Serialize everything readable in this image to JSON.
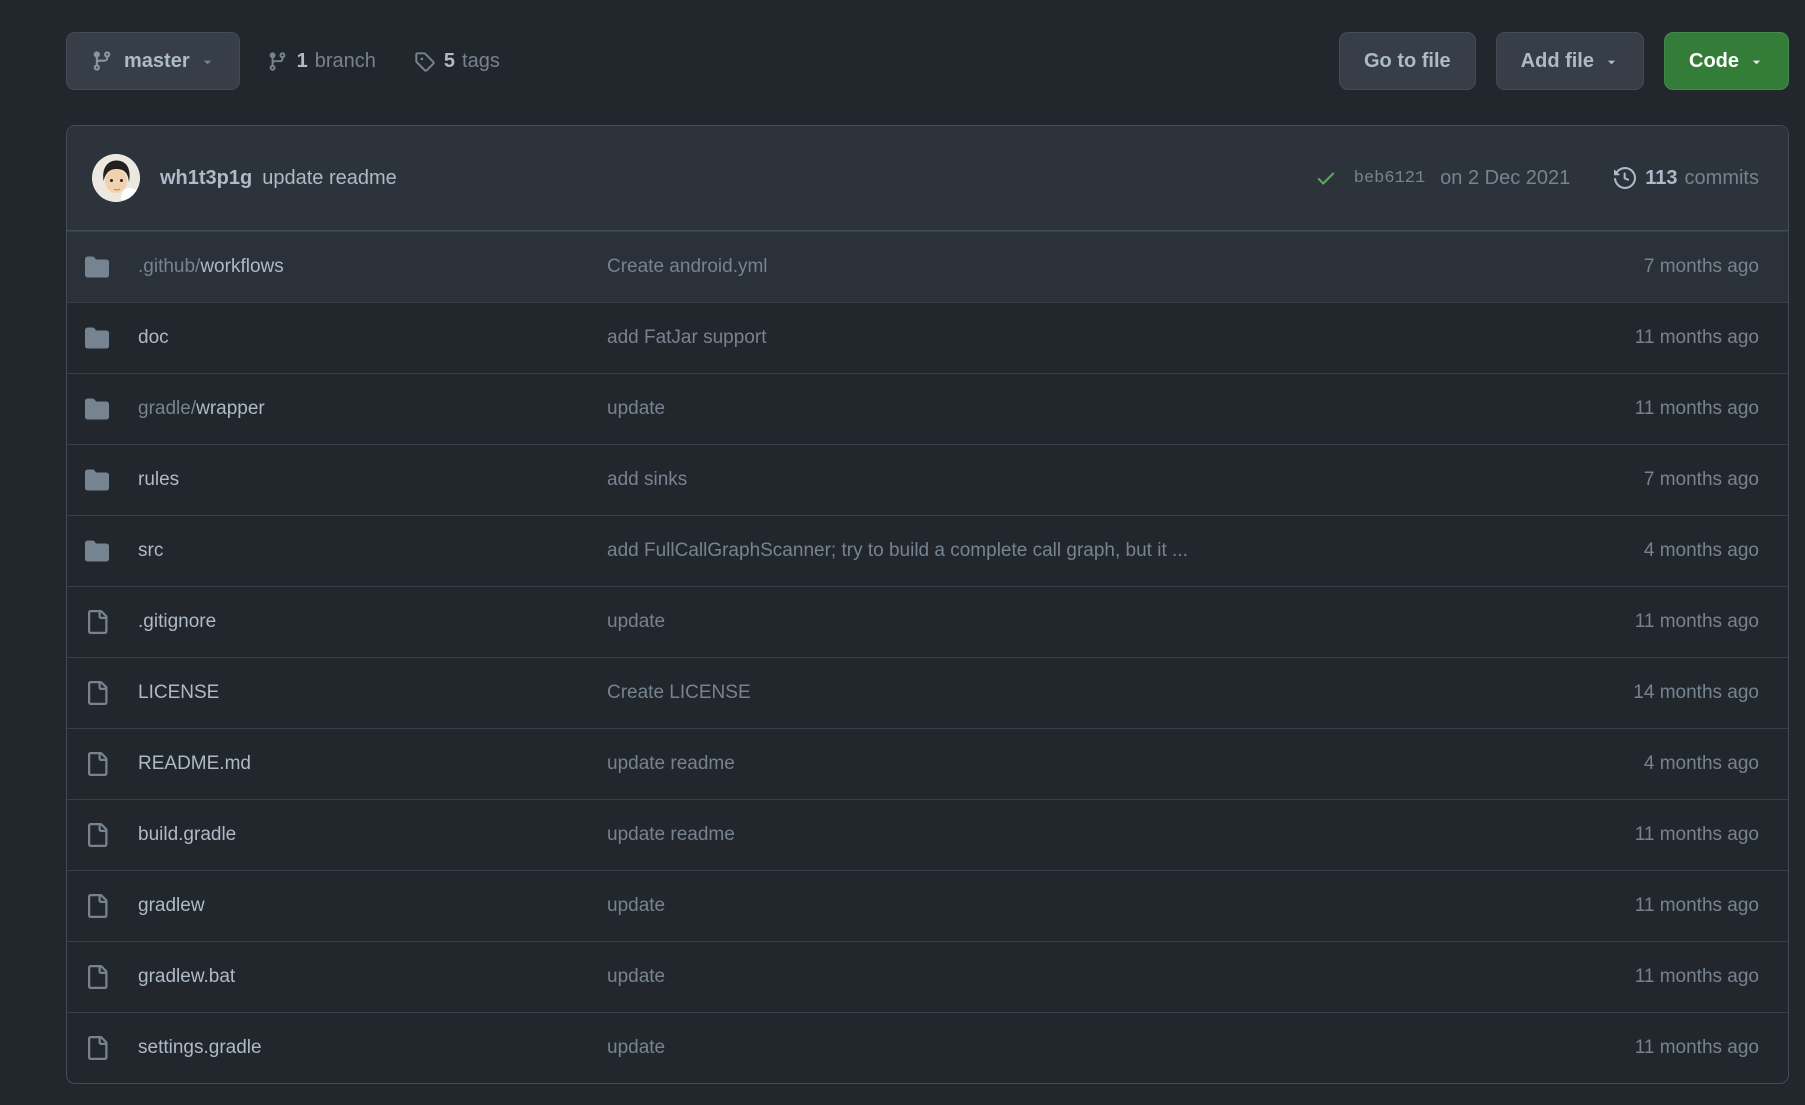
{
  "toolbar": {
    "branch_button": {
      "label": "master"
    },
    "branches": {
      "count": "1",
      "label": "branch"
    },
    "tags": {
      "count": "5",
      "label": "tags"
    },
    "go_to_file_label": "Go to file",
    "add_file_label": "Add file",
    "code_label": "Code"
  },
  "commit_header": {
    "author": "wh1t3p1g",
    "message": "update readme",
    "hash": "beb6121",
    "date": "on 2 Dec 2021",
    "commits_count": "113",
    "commits_label": "commits"
  },
  "files": [
    {
      "type": "dir",
      "prefix": ".github/",
      "name": "workflows",
      "message": "Create android.yml",
      "age": "7 months ago",
      "hovered": true
    },
    {
      "type": "dir",
      "prefix": "",
      "name": "doc",
      "message": "add FatJar support",
      "age": "11 months ago"
    },
    {
      "type": "dir",
      "prefix": "gradle/",
      "name": "wrapper",
      "message": "update",
      "age": "11 months ago"
    },
    {
      "type": "dir",
      "prefix": "",
      "name": "rules",
      "message": "add sinks",
      "age": "7 months ago"
    },
    {
      "type": "dir",
      "prefix": "",
      "name": "src",
      "message": "add FullCallGraphScanner; try to build a complete call graph, but it ...",
      "age": "4 months ago"
    },
    {
      "type": "file",
      "prefix": "",
      "name": ".gitignore",
      "message": "update",
      "age": "11 months ago"
    },
    {
      "type": "file",
      "prefix": "",
      "name": "LICENSE",
      "message": "Create LICENSE",
      "age": "14 months ago"
    },
    {
      "type": "file",
      "prefix": "",
      "name": "README.md",
      "message": "update readme",
      "age": "4 months ago"
    },
    {
      "type": "file",
      "prefix": "",
      "name": "build.gradle",
      "message": "update readme",
      "age": "11 months ago"
    },
    {
      "type": "file",
      "prefix": "",
      "name": "gradlew",
      "message": "update",
      "age": "11 months ago"
    },
    {
      "type": "file",
      "prefix": "",
      "name": "gradlew.bat",
      "message": "update",
      "age": "11 months ago"
    },
    {
      "type": "file",
      "prefix": "",
      "name": "settings.gradle",
      "message": "update",
      "age": "11 months ago"
    }
  ],
  "colors": {
    "page_background": "#22272e",
    "box_header_background": "#2d333b",
    "border": "#444c56",
    "text_default": "#adbac7",
    "text_muted": "#768390",
    "code_button_green": "#347d39",
    "check_green": "#57ab5a"
  }
}
